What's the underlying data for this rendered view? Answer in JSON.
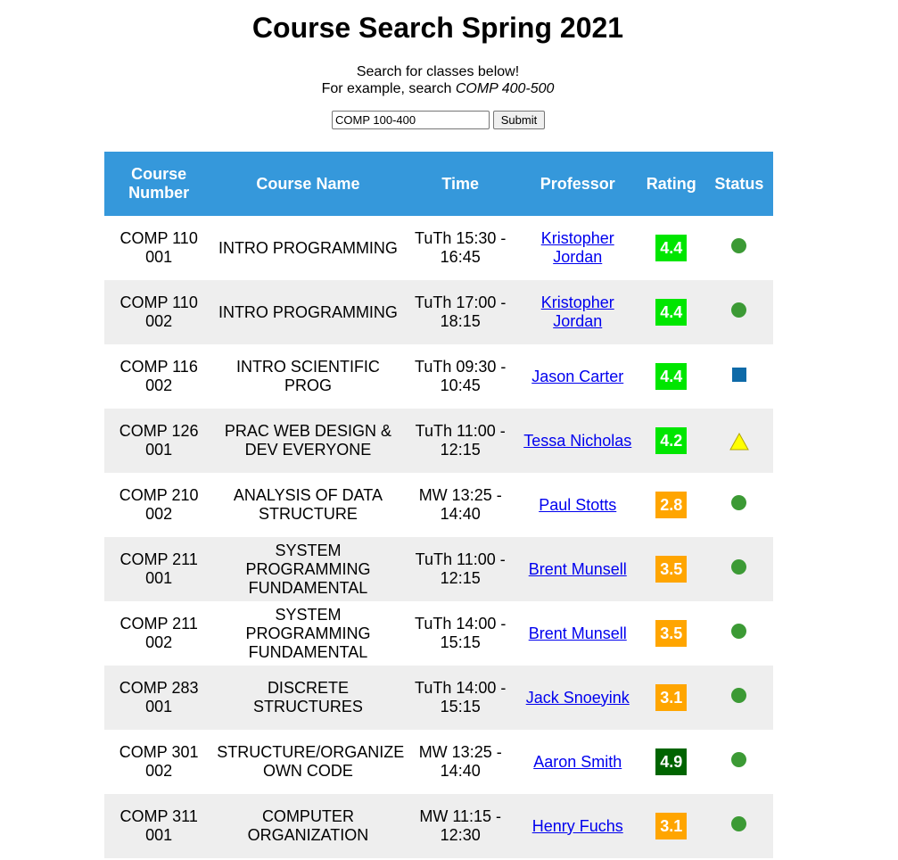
{
  "page": {
    "title": "Course Search Spring 2021",
    "intro_line1": "Search for classes below!",
    "intro_line2_prefix": "For example, search ",
    "intro_line2_example": "COMP 400-500"
  },
  "search": {
    "value": "COMP 100-400",
    "submit_label": "Submit"
  },
  "table": {
    "headers": {
      "course_number": "Course Number",
      "course_name": "Course Name",
      "time": "Time",
      "professor": "Professor",
      "rating": "Rating",
      "status": "Status"
    },
    "header_color": "#3598db",
    "rows": [
      {
        "number": "COMP 110 001",
        "name": "INTRO PROGRAMMING",
        "time": "TuTh 15:30 - 16:45",
        "professor": "Kristopher Jordan",
        "rating": "4.4",
        "rating_color": "#00e600",
        "status": "circle",
        "status_color": "#3c9a35"
      },
      {
        "number": "COMP 110 002",
        "name": "INTRO PROGRAMMING",
        "time": "TuTh 17:00 - 18:15",
        "professor": "Kristopher Jordan",
        "rating": "4.4",
        "rating_color": "#00e600",
        "status": "circle",
        "status_color": "#3c9a35"
      },
      {
        "number": "COMP 116 002",
        "name": "INTRO SCIENTIFIC PROG",
        "time": "TuTh 09:30 - 10:45",
        "professor": "Jason Carter",
        "rating": "4.4",
        "rating_color": "#00e600",
        "status": "square",
        "status_color": "#0e6aa8"
      },
      {
        "number": "COMP 126 001",
        "name": "PRAC WEB DESIGN & DEV EVERYONE",
        "time": "TuTh 11:00 - 12:15",
        "professor": "Tessa Nicholas",
        "rating": "4.2",
        "rating_color": "#00e600",
        "status": "triangle",
        "status_color": "#ffff00"
      },
      {
        "number": "COMP 210 002",
        "name": "ANALYSIS OF DATA STRUCTURE",
        "time": "MW 13:25 - 14:40",
        "professor": "Paul Stotts",
        "rating": "2.8",
        "rating_color": "#ffa500",
        "status": "circle",
        "status_color": "#3c9a35"
      },
      {
        "number": "COMP 211 001",
        "name": "SYSTEM PROGRAMMING FUNDAMENTAL",
        "time": "TuTh 11:00 - 12:15",
        "professor": "Brent Munsell",
        "rating": "3.5",
        "rating_color": "#ffa500",
        "status": "circle",
        "status_color": "#3c9a35"
      },
      {
        "number": "COMP 211 002",
        "name": "SYSTEM PROGRAMMING FUNDAMENTAL",
        "time": "TuTh 14:00 - 15:15",
        "professor": "Brent Munsell",
        "rating": "3.5",
        "rating_color": "#ffa500",
        "status": "circle",
        "status_color": "#3c9a35"
      },
      {
        "number": "COMP 283 001",
        "name": "DISCRETE STRUCTURES",
        "time": "TuTh 14:00 - 15:15",
        "professor": "Jack Snoeyink",
        "rating": "3.1",
        "rating_color": "#ffa500",
        "status": "circle",
        "status_color": "#3c9a35"
      },
      {
        "number": "COMP 301 002",
        "name": "STRUCTURE/ORGANIZE OWN CODE",
        "time": "MW 13:25 - 14:40",
        "professor": "Aaron Smith",
        "rating": "4.9",
        "rating_color": "#006400",
        "status": "circle",
        "status_color": "#3c9a35"
      },
      {
        "number": "COMP 311 001",
        "name": "COMPUTER ORGANIZATION",
        "time": "MW 11:15 - 12:30",
        "professor": "Henry Fuchs",
        "rating": "3.1",
        "rating_color": "#ffa500",
        "status": "circle",
        "status_color": "#3c9a35"
      }
    ]
  }
}
